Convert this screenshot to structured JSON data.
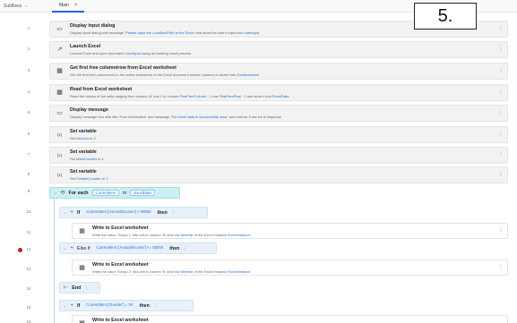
{
  "tabs": {
    "subflows_label": "Subflows",
    "main_label": "Main"
  },
  "overlay_label": "5.",
  "actions": [
    {
      "ln": "1",
      "title": "Display input dialog",
      "pre": "Display input dialog with message ",
      "s1": "'Please Input the Location/Path of the Excel'",
      "mid": " and store the user's input into ",
      "v1": "UserInput",
      "post": ""
    },
    {
      "ln": "2",
      "title": "Launch Excel",
      "pre": "Launch Excel and open document ",
      "s1": "",
      "v0": "UserInput",
      "mid": " using an existing excel process",
      "v1": "",
      "post": ""
    },
    {
      "ln": "3",
      "title": "Get first free column/row from Excel worksheet",
      "pre": "Get the first free column/row in the active worksheet of the Excel document whose instance is stored into ",
      "s1": "",
      "mid": "",
      "v1": "ExcelInstance",
      "post": ""
    },
    {
      "ln": "4",
      "title": "Read from Excel worksheet",
      "pre": "Read the values of the cells ranging from column 'A' row 1 to column ",
      "s1": "",
      "v0": "FirstFreeColumn",
      "mid": " - 1 row ",
      "v1": "FirstFreeRow",
      "post": " - 1 and store it into ",
      "v2": "ExcelData"
    },
    {
      "ln": "5",
      "title": "Display message",
      "pre": "Display message box with title 'Flow Information' and message ",
      "s1": "'The excel data is successfully read.'",
      "mid": " and wait for 3 sec for a response",
      "v1": "",
      "post": ""
    },
    {
      "ln": "6",
      "title": "Set variable",
      "pre": "Set ",
      "s1": "",
      "v0": "NewVar",
      "mid": " to 2",
      "v1": "",
      "post": ""
    },
    {
      "ln": "7",
      "title": "Set variable",
      "pre": "Set ",
      "s1": "",
      "v0": "MaleCounter",
      "mid": " to 1",
      "v1": "",
      "post": ""
    },
    {
      "ln": "8",
      "title": "Set variable",
      "pre": "Set ",
      "s1": "",
      "v0": "FeMaleCounter",
      "mid": " to 1",
      "v1": "",
      "post": ""
    }
  ],
  "foreach": {
    "ln": "9",
    "kw": "For each",
    "item": "CurrentItem",
    "in_kw": "in",
    "source": "ExcelData"
  },
  "if1": {
    "ln": "10",
    "kw": "If",
    "cond": "CurrentItem ['AnnualIncome'] > 50000",
    "then_kw": "then"
  },
  "write1": {
    "ln": "11",
    "title": "Write to Excel worksheet",
    "pre": "Write the value 'Group 1' into cell in column 'N' and row ",
    "v0": "NewVar",
    "mid": " of the Excel instance ",
    "v1": "ExcelInstance"
  },
  "elseif": {
    "ln": "12",
    "kw": "Else if",
    "cond": "CurrentItem ['AnnualIncome'] <= 50000",
    "then_kw": "then"
  },
  "write2": {
    "ln": "13",
    "title": "Write to Excel worksheet",
    "pre": "Write the value 'Group 2' into cell in column 'N' and row ",
    "v0": "NewVar",
    "mid": " of the Excel instance ",
    "v1": "ExcelInstance"
  },
  "end": {
    "ln": "14",
    "kw": "End"
  },
  "if2": {
    "ln": "15",
    "kw": "If",
    "cond": "CurrentItem ['Gender'] = 'M'",
    "then_kw": "then"
  },
  "write3": {
    "ln": "16",
    "title": "Write to Excel worksheet"
  },
  "icons": {
    "dialog": "dialog-icon",
    "launch": "launch-arrow-icon",
    "table": "table-icon",
    "message": "message-icon",
    "variable": "variable-icon",
    "loop": "loop-icon",
    "branch": "branch-icon",
    "end": "end-icon",
    "breakpoint": "breakpoint-icon"
  },
  "colors": {
    "accent": "#2563eb",
    "variable": "#1e6fd9",
    "breakpoint": "#c0202a",
    "loop_bg": "#cdeff3"
  }
}
